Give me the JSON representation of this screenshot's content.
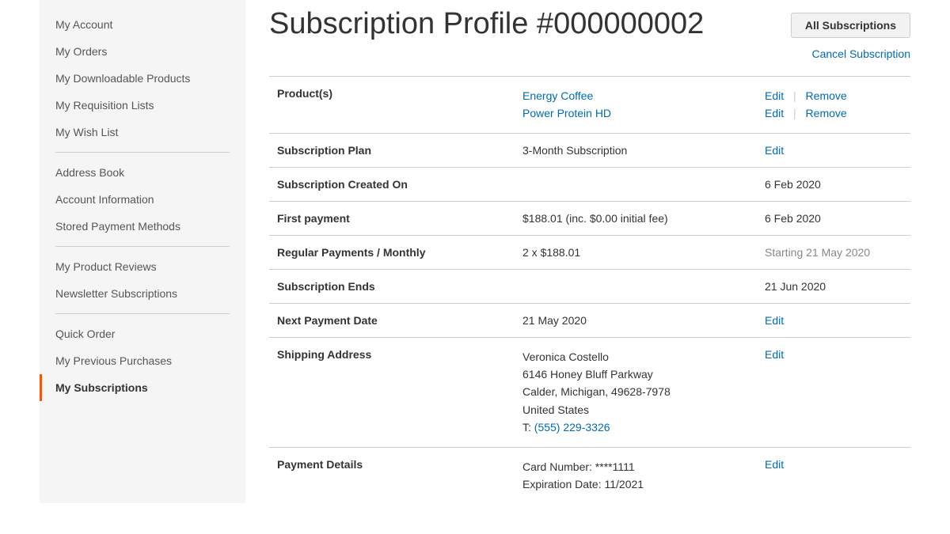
{
  "sidebar": {
    "group1": [
      {
        "label": "My Account",
        "name": "my-account"
      },
      {
        "label": "My Orders",
        "name": "my-orders"
      },
      {
        "label": "My Downloadable Products",
        "name": "my-downloadable-products"
      },
      {
        "label": "My Requisition Lists",
        "name": "my-requisition-lists"
      },
      {
        "label": "My Wish List",
        "name": "my-wish-list"
      }
    ],
    "group2": [
      {
        "label": "Address Book",
        "name": "address-book"
      },
      {
        "label": "Account Information",
        "name": "account-information"
      },
      {
        "label": "Stored Payment Methods",
        "name": "stored-payment-methods"
      }
    ],
    "group3": [
      {
        "label": "My Product Reviews",
        "name": "my-product-reviews"
      },
      {
        "label": "Newsletter Subscriptions",
        "name": "newsletter-subscriptions"
      }
    ],
    "group4": [
      {
        "label": "Quick Order",
        "name": "quick-order"
      },
      {
        "label": "My Previous Purchases",
        "name": "my-previous-purchases"
      },
      {
        "label": "My Subscriptions",
        "name": "my-subscriptions",
        "active": true
      }
    ]
  },
  "header": {
    "title": "Subscription Profile #000000002",
    "all_subs_label": "All Subscriptions",
    "cancel_label": "Cancel Subscription"
  },
  "labels": {
    "products": "Product(s)",
    "plan": "Subscription Plan",
    "created": "Subscription Created On",
    "first_payment": "First payment",
    "regular": "Regular Payments / Monthly",
    "ends": "Subscription Ends",
    "next_payment": "Next Payment Date",
    "shipping": "Shipping Address",
    "payment": "Payment Details",
    "edit": "Edit",
    "remove": "Remove",
    "sep": "|"
  },
  "products": [
    {
      "name": "Energy Coffee"
    },
    {
      "name": "Power Protein HD"
    }
  ],
  "plan": {
    "value": "3-Month Subscription"
  },
  "created": {
    "date": "6 Feb 2020"
  },
  "first_payment": {
    "value": "$188.01 (inc. $0.00 initial fee)",
    "date": "6 Feb 2020"
  },
  "regular": {
    "value": "2 x $188.01",
    "starting": "Starting 21 May 2020"
  },
  "ends": {
    "date": "21 Jun 2020"
  },
  "next_payment": {
    "date": "21 May 2020"
  },
  "shipping": {
    "name": "Veronica Costello",
    "street": "6146 Honey Bluff Parkway",
    "city": "Calder, Michigan, 49628-7978",
    "country": "United States",
    "tel_prefix": "T: ",
    "tel": "(555) 229-3326"
  },
  "payment": {
    "card": "Card Number: ****1111",
    "exp": "Expiration Date: 11/2021"
  }
}
